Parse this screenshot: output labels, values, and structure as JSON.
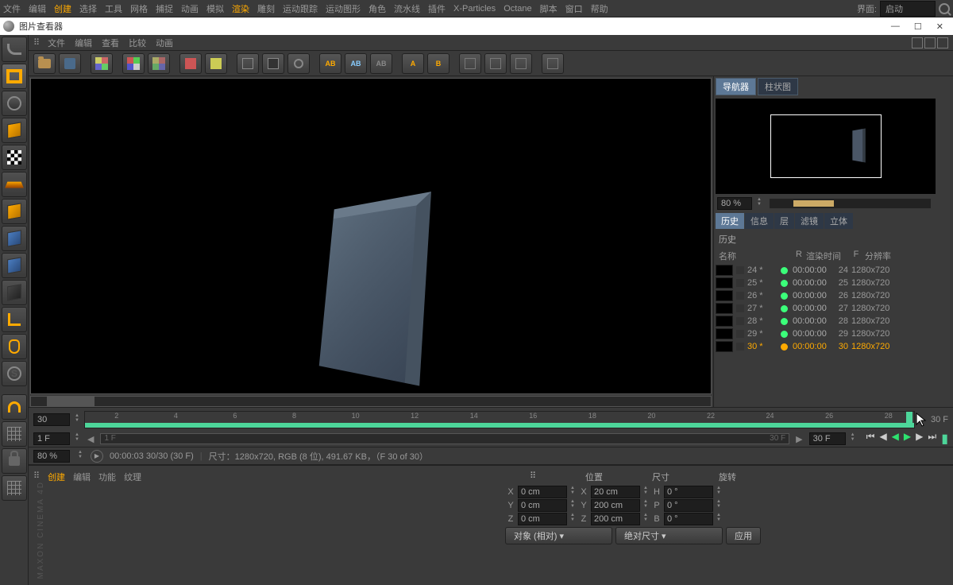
{
  "menubar": [
    "文件",
    "编辑",
    "创建",
    "选择",
    "工具",
    "网格",
    "捕捉",
    "动画",
    "模拟",
    "渲染",
    "雕刻",
    "运动跟踪",
    "运动图形",
    "角色",
    "流水线",
    "插件",
    "X-Particles",
    "Octane",
    "脚本",
    "窗口",
    "帮助"
  ],
  "menubar_highlight": [
    2,
    9
  ],
  "layout_label": "界面:",
  "layout_value": "启动",
  "window_title": "图片查看器",
  "viewer_menu": [
    "文件",
    "编辑",
    "查看",
    "比较",
    "动画"
  ],
  "nav_tabs": {
    "nav": "导航器",
    "hist": "柱状图"
  },
  "zoom": "80 %",
  "info_tabs": [
    "历史",
    "信息",
    "层",
    "滤镜",
    "立体"
  ],
  "history_title": "历史",
  "history_cols": {
    "name": "名称",
    "r": "R",
    "time": "渲染时间",
    "f": "F",
    "res": "分辨率"
  },
  "history": [
    {
      "name": "24 *",
      "time": "00:00:00",
      "frame": "24",
      "res": "1280x720",
      "sel": false
    },
    {
      "name": "25 *",
      "time": "00:00:00",
      "frame": "25",
      "res": "1280x720",
      "sel": false
    },
    {
      "name": "26 *",
      "time": "00:00:00",
      "frame": "26",
      "res": "1280x720",
      "sel": false
    },
    {
      "name": "27 *",
      "time": "00:00:00",
      "frame": "27",
      "res": "1280x720",
      "sel": false
    },
    {
      "name": "28 *",
      "time": "00:00:00",
      "frame": "28",
      "res": "1280x720",
      "sel": false
    },
    {
      "name": "29 *",
      "time": "00:00:00",
      "frame": "29",
      "res": "1280x720",
      "sel": false
    },
    {
      "name": "30 *",
      "time": "00:00:00",
      "frame": "30",
      "res": "1280x720",
      "sel": true
    }
  ],
  "timeline": {
    "start": "30",
    "ticks": [
      "2",
      "4",
      "6",
      "8",
      "10",
      "12",
      "14",
      "16",
      "18",
      "20",
      "22",
      "24",
      "26",
      "28"
    ],
    "end": "30 F"
  },
  "scrub": {
    "left": "1 F",
    "ph": "1 F",
    "right": "30 F",
    "field": "30 F"
  },
  "info_line": {
    "zoom": "80 %",
    "time": "00:00:03 30/30 (30 F)",
    "size": "尺寸：1280x720, RGB (8 位), 491.67 KB，（F 30 of 30）"
  },
  "mat_panel": [
    "创建",
    "编辑",
    "功能",
    "纹理"
  ],
  "coords": {
    "hdr_pos": "位置",
    "hdr_size": "尺寸",
    "hdr_rot": "旋转",
    "rows": [
      {
        "a": "X",
        "pos": "0 cm",
        "al": "X",
        "size": "20 cm",
        "rl": "H",
        "rot": "0 °"
      },
      {
        "a": "Y",
        "pos": "0 cm",
        "al": "Y",
        "size": "200 cm",
        "rl": "P",
        "rot": "0 °"
      },
      {
        "a": "Z",
        "pos": "0 cm",
        "al": "Z",
        "size": "200 cm",
        "rl": "B",
        "rot": "0 °"
      }
    ],
    "obj_sel": "对象 (相对)",
    "abs_sel": "绝对尺寸",
    "apply": "应用"
  },
  "brand": "MAXON CINEMA 4D"
}
